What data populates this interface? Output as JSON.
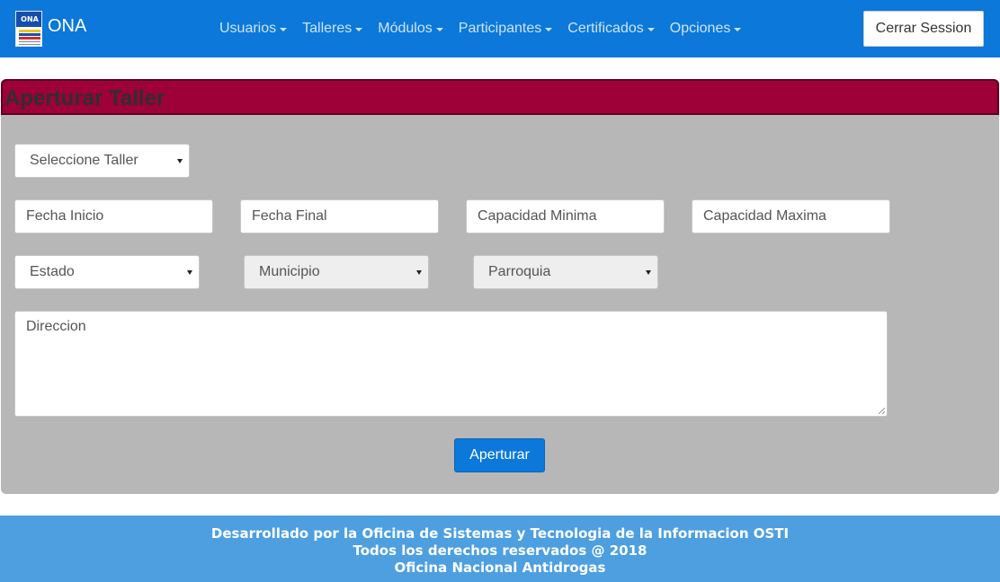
{
  "brand": {
    "name": "ONA",
    "logo_text": "ONA"
  },
  "nav": {
    "items": [
      {
        "label": "Usuarios"
      },
      {
        "label": "Talleres"
      },
      {
        "label": "Módulos"
      },
      {
        "label": "Participantes"
      },
      {
        "label": "Certificados"
      },
      {
        "label": "Opciones"
      }
    ],
    "logout_label": "Cerrar Session"
  },
  "panel": {
    "title": "Aperturar Taller",
    "taller_select": "Seleccione Taller",
    "fecha_inicio_placeholder": "Fecha Inicio",
    "fecha_final_placeholder": "Fecha Final",
    "capacidad_minima_placeholder": "Capacidad Minima",
    "capacidad_maxima_placeholder": "Capacidad Maxima",
    "estado_select": "Estado",
    "municipio_select": "Municipio",
    "parroquia_select": "Parroquia",
    "direccion_placeholder": "Direccion",
    "submit_label": "Aperturar"
  },
  "footer": {
    "line1": "Desarrollado por la Oficina de Sistemas y Tecnologia de la Informacion OSTI",
    "line2": "Todos los derechos reservados @ 2018",
    "line3": "Oficina Nacional Antidrogas"
  },
  "colors": {
    "navbar": "#0c78d9",
    "panel_header": "#9e0038",
    "panel_body": "#b7b7b7",
    "footer": "#4d9fe0"
  }
}
